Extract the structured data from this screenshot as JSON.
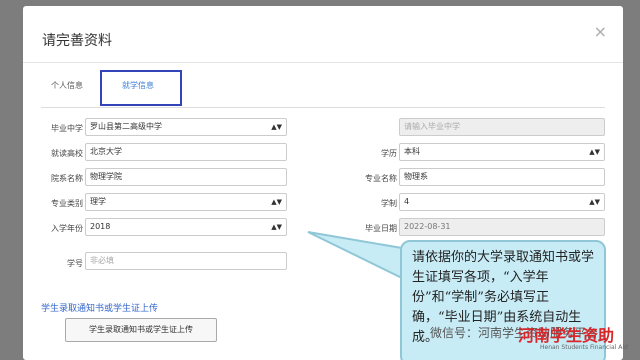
{
  "modal": {
    "title": "请完善资料",
    "close": "×"
  },
  "tabs": [
    {
      "label": "个人信息"
    },
    {
      "label": "就学信息"
    }
  ],
  "form": {
    "graduation_school": {
      "label": "毕业中学",
      "value": "罗山县第二高级中学"
    },
    "graduation_school_input": {
      "placeholder": "请输入毕业中学"
    },
    "university": {
      "label": "就读高校",
      "value": "北京大学"
    },
    "degree": {
      "label": "学历",
      "value": "本科"
    },
    "college": {
      "label": "院系名称",
      "value": "物理学院"
    },
    "major": {
      "label": "专业名称",
      "value": "物理系"
    },
    "major_type": {
      "label": "专业类别",
      "value": "理学"
    },
    "duration": {
      "label": "学制",
      "value": "4"
    },
    "enroll_year": {
      "label": "入学年份",
      "value": "2018"
    },
    "grad_date": {
      "label": "毕业日期",
      "value": "2022-08-31"
    },
    "student_id": {
      "label": "学号",
      "placeholder": "非必填"
    }
  },
  "upload": {
    "section_title": "学生录取通知书或学生证上传",
    "button_label": "学生录取通知书或学生证上传"
  },
  "callout": {
    "text": "请依据你的大学录取通知书或学生证填写各项，“入学年份”和“学制”务必填写正确，“毕业日期”由系统自动生成。"
  },
  "watermark": {
    "text": "微信号：河南学生资助服务平台",
    "logo": "河南学生资助",
    "sub": "Henan Students Financial Aid"
  },
  "colors": {
    "accent": "#3366cc",
    "highlight_border": "#3344b8",
    "callout_bg": "#c8ecf6"
  }
}
